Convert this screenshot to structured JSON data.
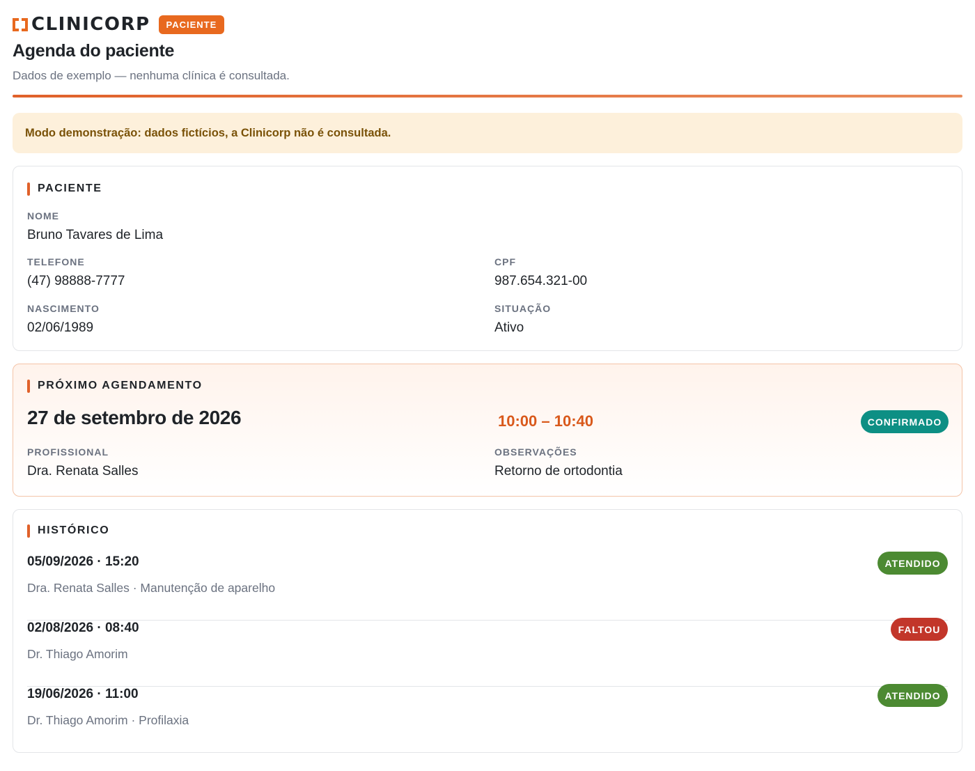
{
  "header": {
    "logo_text": "CLINICORP",
    "badge": "PACIENTE",
    "title": "Agenda do paciente",
    "subtitle": "Dados de exemplo — nenhuma clínica é consultada."
  },
  "notice": "Modo demonstração: dados fictícios, a Clinicorp não é consultada.",
  "patient": {
    "section_title": "PACIENTE",
    "name_label": "NOME",
    "name": "Bruno Tavares de Lima",
    "phone_label": "TELEFONE",
    "phone": "(47) 98888-7777",
    "cpf_label": "CPF",
    "cpf": "987.654.321-00",
    "birth_label": "NASCIMENTO",
    "birth": "02/06/1989",
    "status_label": "SITUAÇÃO",
    "status": "Ativo"
  },
  "next_appointment": {
    "section_title": "PRÓXIMO AGENDAMENTO",
    "date": "27 de setembro de 2026",
    "time": "10:00 – 10:40",
    "status": "CONFIRMADO",
    "professional_label": "PROFISSIONAL",
    "professional": "Dra. Renata Salles",
    "notes_label": "OBSERVAÇÕES",
    "notes": "Retorno de ortodontia"
  },
  "history": {
    "section_title": "HISTÓRICO",
    "items": [
      {
        "when": "05/09/2026 · 15:20",
        "desc": "Dra. Renata Salles · Manutenção de aparelho",
        "status": "ATENDIDO"
      },
      {
        "when": "02/08/2026 · 08:40",
        "desc": "Dr. Thiago Amorim",
        "status": "FALTOU"
      },
      {
        "when": "19/06/2026 · 11:00",
        "desc": "Dr. Thiago Amorim · Profilaxia",
        "status": "ATENDIDO"
      }
    ]
  },
  "colors": {
    "brand": "#e8691f",
    "confirmed": "#0d8f84",
    "attended": "#4c8a32",
    "missed": "#c2362a"
  }
}
